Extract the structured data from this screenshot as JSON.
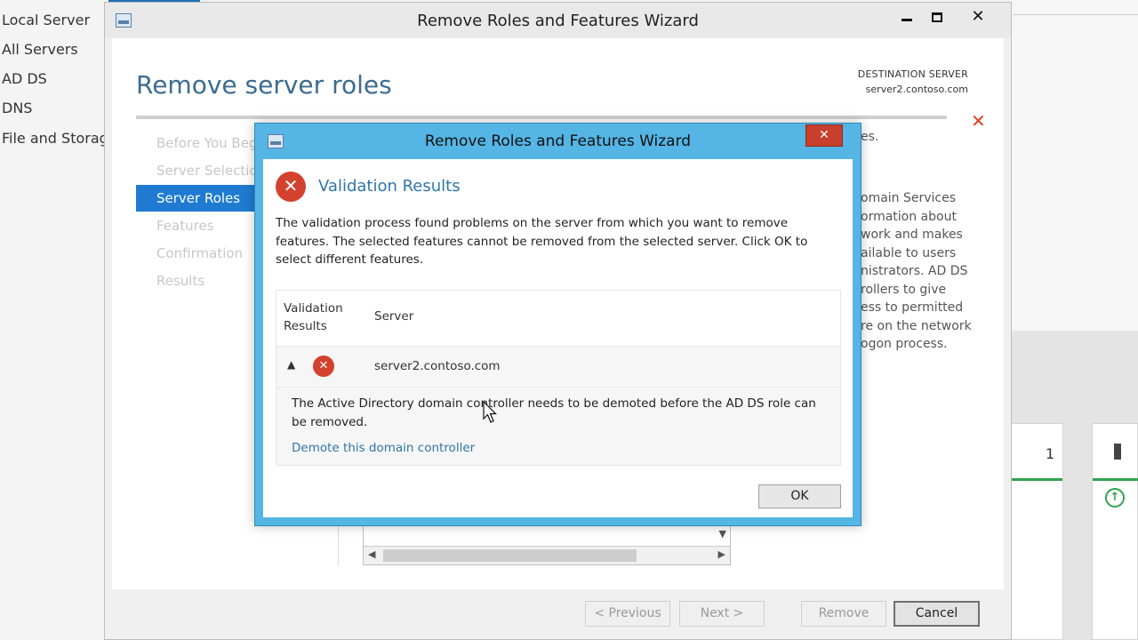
{
  "server_manager": {
    "nav_items": [
      "Local Server",
      "All Servers",
      "AD DS",
      "DNS",
      "File and Storag"
    ],
    "tile_count": "1"
  },
  "wizard": {
    "window_title": "Remove Roles and Features Wizard",
    "page_title": "Remove server roles",
    "destination_label": "DESTINATION SERVER",
    "destination_server": "server2.contoso.com",
    "steps": [
      {
        "label": "Before You Begin",
        "state": "inactive"
      },
      {
        "label": "Server Selection",
        "state": "inactive"
      },
      {
        "label": "Server Roles",
        "state": "active"
      },
      {
        "label": "Features",
        "state": "inactive"
      },
      {
        "label": "Confirmation",
        "state": "inactive"
      },
      {
        "label": "Results",
        "state": "inactive"
      }
    ],
    "background_desc_top": "es.",
    "background_desc_lines": [
      "omain Services",
      "ormation about",
      "work and makes",
      "ailable to users",
      "nistrators. AD DS",
      "rollers to give",
      "ess to permitted",
      "re on the network",
      "ogon process."
    ],
    "buttons": {
      "previous": "< Previous",
      "next": "Next >",
      "remove": "Remove",
      "cancel": "Cancel"
    },
    "controls": {
      "minimize": "",
      "maximize": "",
      "close": "✕"
    }
  },
  "dialog": {
    "title": "Remove Roles and Features Wizard",
    "close_glyph": "✕",
    "heading": "Validation Results",
    "description": "The validation process found problems on the server from which you want to remove features. The selected features cannot be removed from the selected server.  Click OK to select different features.",
    "columns": {
      "validation": "Validation Results",
      "server": "Server"
    },
    "row": {
      "server": "server2.contoso.com"
    },
    "detail_message": "The Active Directory domain controller needs to be demoted before the AD DS role can be removed.",
    "detail_link": "Demote this domain controller",
    "ok_label": "OK"
  },
  "colors": {
    "accent_blue": "#1f7bd1",
    "dialog_frame": "#55b5e4",
    "error_red": "#d4412f",
    "link_blue": "#2f76a8"
  }
}
